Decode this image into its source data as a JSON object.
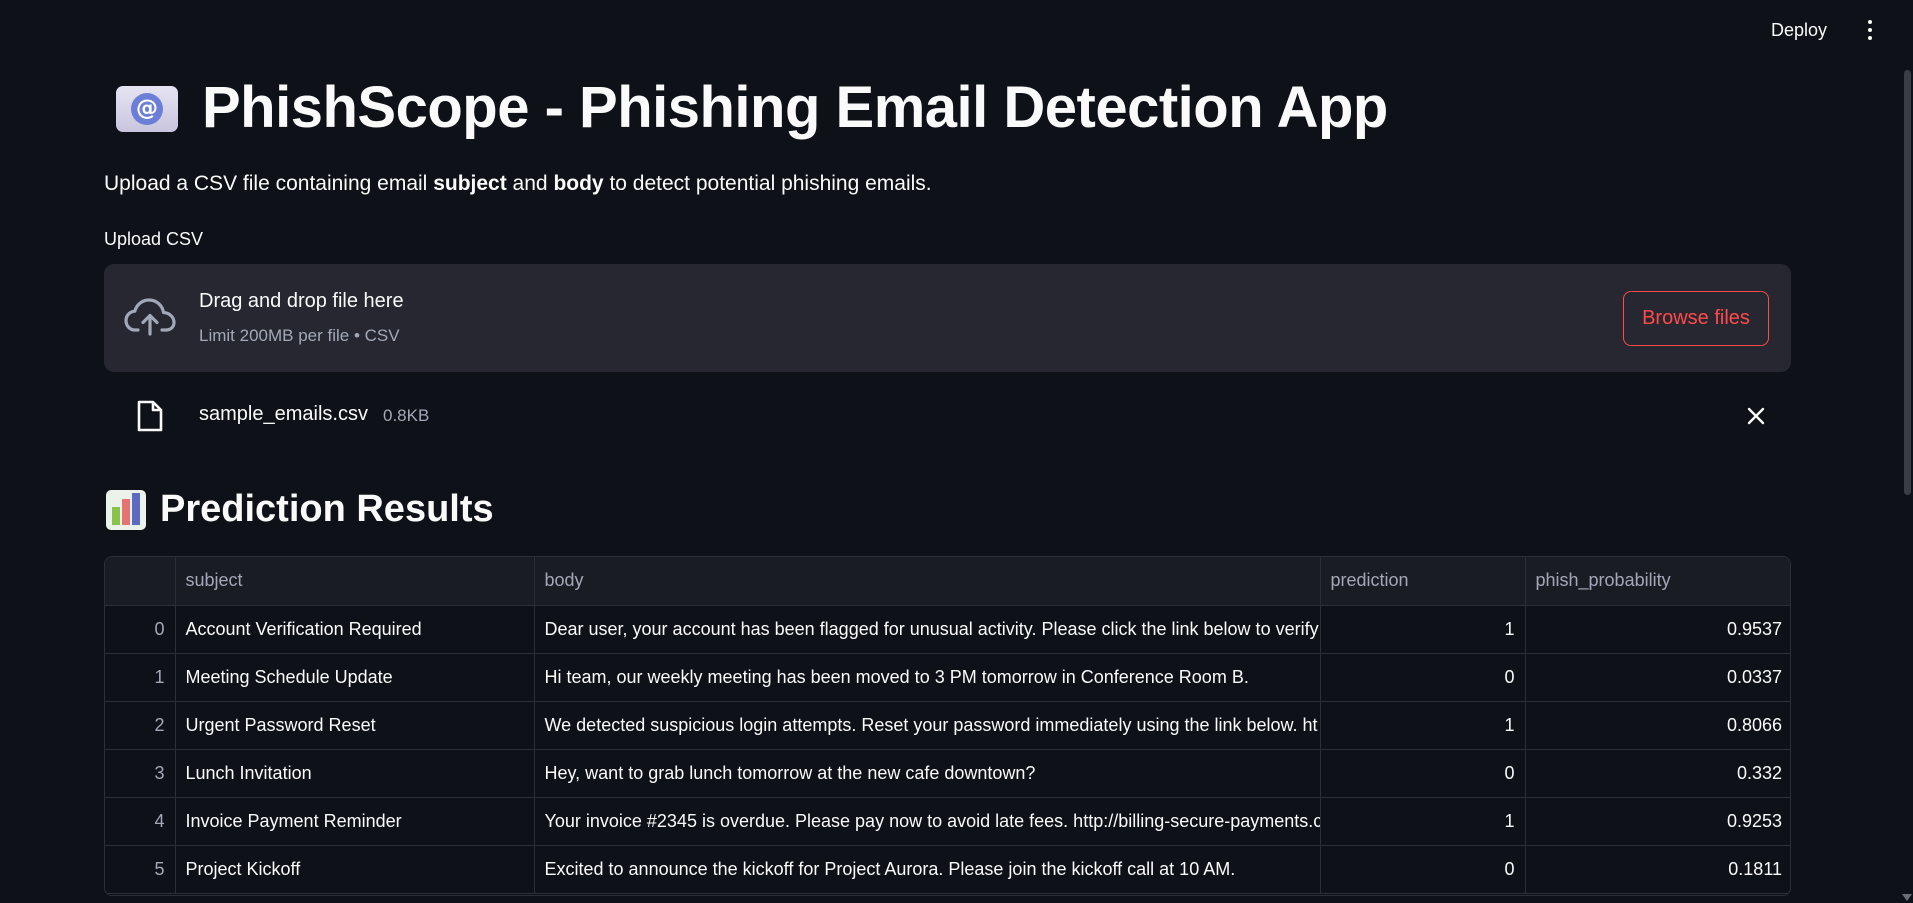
{
  "header": {
    "deploy_label": "Deploy"
  },
  "page": {
    "title": "PhishScope - Phishing Email Detection App",
    "intro": {
      "part1": "Upload a CSV file containing email ",
      "bold1": "subject",
      "part2": " and ",
      "bold2": "body",
      "part3": " to detect potential phishing emails."
    }
  },
  "uploader": {
    "label": "Upload CSV",
    "drop_title": "Drag and drop file here",
    "drop_subtitle": "Limit 200MB per file • CSV",
    "browse_label": "Browse files",
    "file": {
      "name": "sample_emails.csv",
      "size": "0.8KB"
    }
  },
  "results": {
    "title": "Prediction Results",
    "columns": [
      "",
      "subject",
      "body",
      "prediction",
      "phish_probability"
    ],
    "rows": [
      {
        "index": "0",
        "subject": "Account Verification Required",
        "body": "Dear user, your account has been flagged for unusual activity. Please click the link below to verify",
        "prediction": "1",
        "phish_probability": "0.9537"
      },
      {
        "index": "1",
        "subject": "Meeting Schedule Update",
        "body": "Hi team, our weekly meeting has been moved to 3 PM tomorrow in Conference Room B.",
        "prediction": "0",
        "phish_probability": "0.0337"
      },
      {
        "index": "2",
        "subject": "Urgent Password Reset",
        "body": "We detected suspicious login attempts. Reset your password immediately using the link below. ht",
        "prediction": "1",
        "phish_probability": "0.8066"
      },
      {
        "index": "3",
        "subject": "Lunch Invitation",
        "body": "Hey, want to grab lunch tomorrow at the new cafe downtown?",
        "prediction": "0",
        "phish_probability": "0.332"
      },
      {
        "index": "4",
        "subject": "Invoice Payment Reminder",
        "body": "Your invoice #2345 is overdue. Please pay now to avoid late fees. http://billing-secure-payments.c",
        "prediction": "1",
        "phish_probability": "0.9253"
      },
      {
        "index": "5",
        "subject": "Project Kickoff",
        "body": "Excited to announce the kickoff for Project Aurora. Please join the kickoff call at 10 AM.",
        "prediction": "0",
        "phish_probability": "0.1811"
      }
    ]
  },
  "icons": {
    "title_emoji": "email-icon",
    "results_emoji": "bar-chart-icon",
    "upload": "cloud-upload-icon",
    "file": "file-icon",
    "remove": "close-icon",
    "menu": "vertical-dots-icon"
  },
  "colors": {
    "background": "#0e1117",
    "surface": "#262730",
    "accent": "#ff4b4b",
    "muted_text": "#a3a8b8"
  }
}
